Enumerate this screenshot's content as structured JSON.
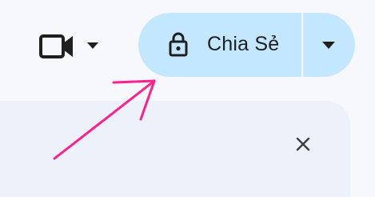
{
  "toolbar": {
    "camera_icon": "video-camera-icon",
    "camera_menu_icon": "caret-down-icon",
    "share": {
      "lock_icon": "lock-icon",
      "label": "Chia Sẻ",
      "menu_icon": "caret-down-icon",
      "background_color": "#c2e7ff"
    }
  },
  "panel": {
    "background_color": "#edf2fa",
    "close_icon": "close-icon"
  },
  "annotation": {
    "arrow_icon": "pointer-arrow",
    "color": "#ff1f8e"
  },
  "colors": {
    "page_background": "#f7f8fc",
    "icon": "#1f1f1f"
  }
}
